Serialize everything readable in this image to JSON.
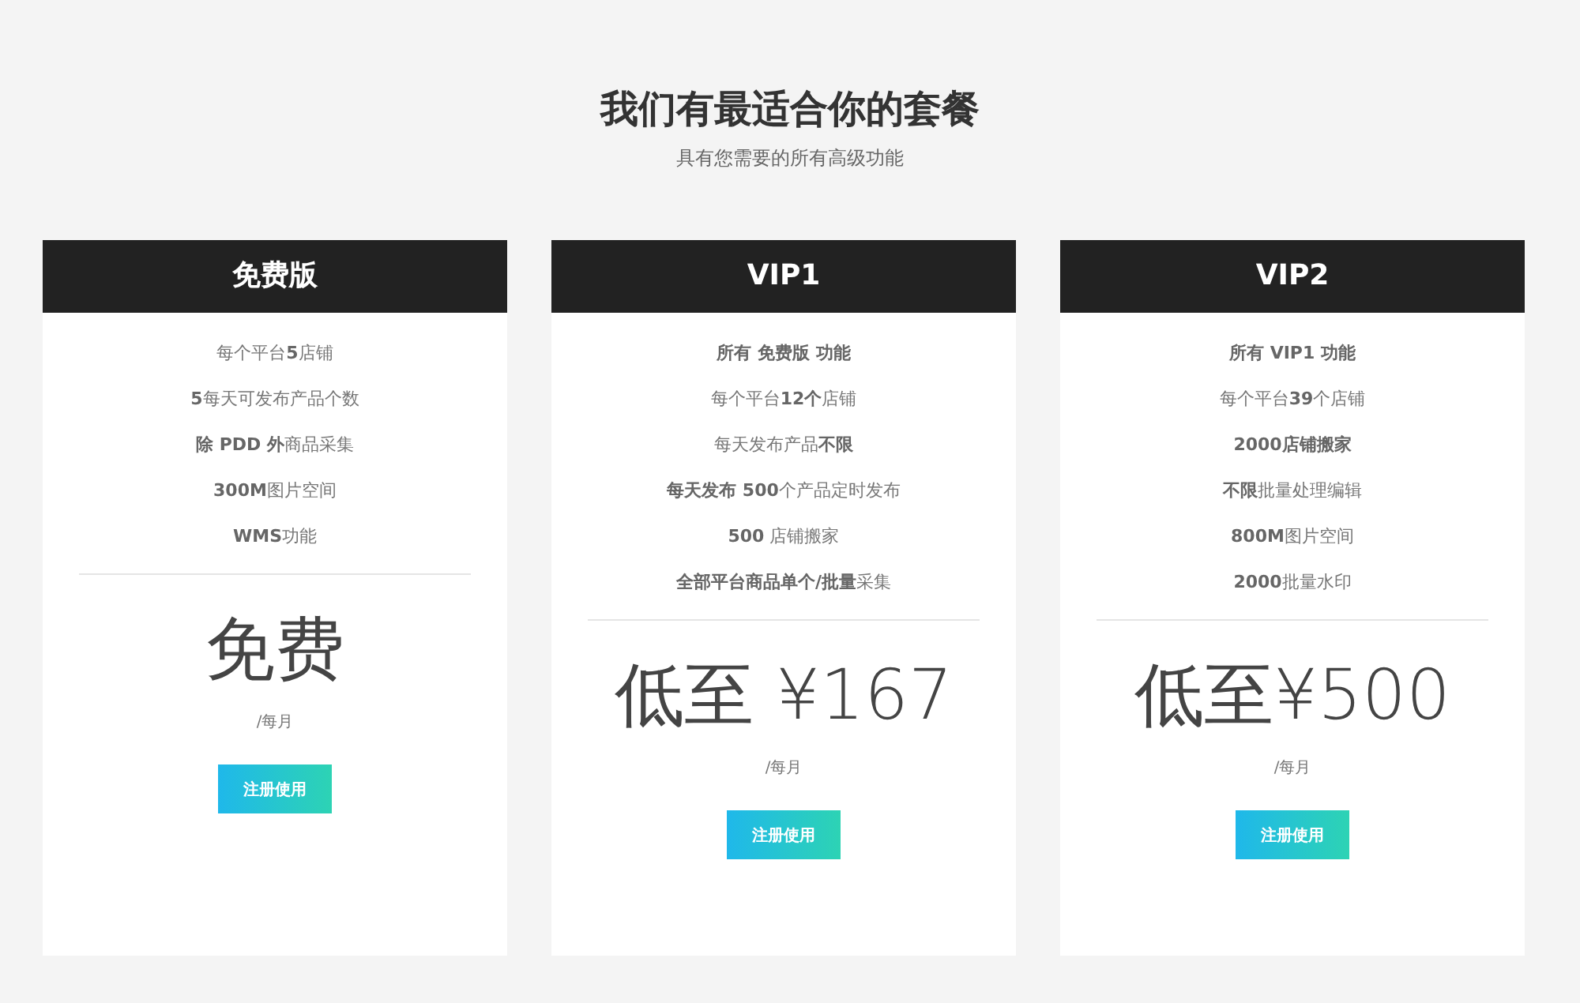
{
  "heading": {
    "title": "我们有最适合你的套餐",
    "subtitle": "具有您需要的所有高级功能"
  },
  "plans": [
    {
      "name": "免费版",
      "features": [
        {
          "text": "每个平台**5**店铺",
          "bold": false
        },
        {
          "text": "**5**每天可发布产品个数",
          "bold": false
        },
        {
          "text": "**除 PDD 外**商品采集",
          "bold": false
        },
        {
          "text": "**300M**图片空间",
          "bold": false
        },
        {
          "text": "**WMS**功能",
          "bold": false
        }
      ],
      "price": "免费",
      "period": "/每月",
      "button": "注册使用"
    },
    {
      "name": "VIP1",
      "features": [
        {
          "text": "所有 免费版 功能",
          "bold": true
        },
        {
          "text": "每个平台**12个**店铺",
          "bold": false
        },
        {
          "text": "每天发布产品**不限**",
          "bold": false
        },
        {
          "text": "**每天发布 500**个产品定时发布",
          "bold": false
        },
        {
          "text": "**500** 店铺搬家",
          "bold": false
        },
        {
          "text": "**全部平台商品单个/批量**采集",
          "bold": false
        }
      ],
      "price": "低至 ¥167",
      "period": "/每月",
      "button": "注册使用"
    },
    {
      "name": "VIP2",
      "features": [
        {
          "text": "所有 VIP1 功能",
          "bold": true
        },
        {
          "text": "每个平台**39**个店铺",
          "bold": false
        },
        {
          "text": "2000店铺搬家",
          "bold": true
        },
        {
          "text": "**不限**批量处理编辑",
          "bold": false
        },
        {
          "text": "**800M**图片空间",
          "bold": false
        },
        {
          "text": "**2000**批量水印",
          "bold": false
        }
      ],
      "price": "低至¥500",
      "period": "/每月",
      "button": "注册使用"
    }
  ]
}
